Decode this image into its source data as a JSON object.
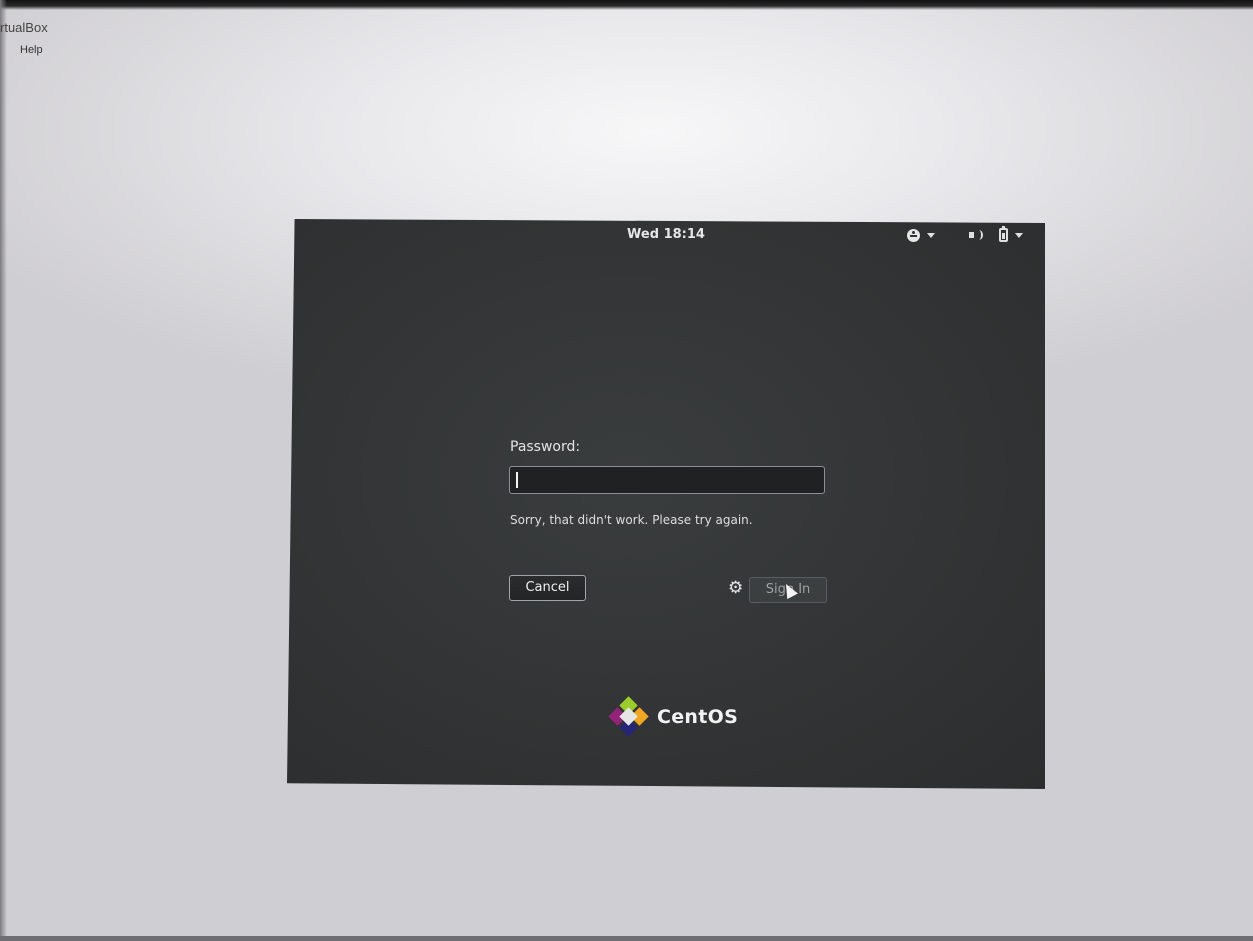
{
  "host": {
    "window_title": "rtualBox",
    "menu_help": "Help"
  },
  "topbar": {
    "clock": "Wed 18:14",
    "icons": [
      "accessibility-icon",
      "volume-icon",
      "battery-icon"
    ]
  },
  "login": {
    "password_label": "Password:",
    "password_value": "",
    "error_message": "Sorry, that didn't work. Please try again.",
    "cancel_label": "Cancel",
    "signin_label": "Sign In",
    "settings_icon": "gear-icon"
  },
  "branding": {
    "logo_text": "CentOS",
    "logo_colors": [
      "#9ccd2a",
      "#efa724",
      "#262577",
      "#932279"
    ]
  }
}
